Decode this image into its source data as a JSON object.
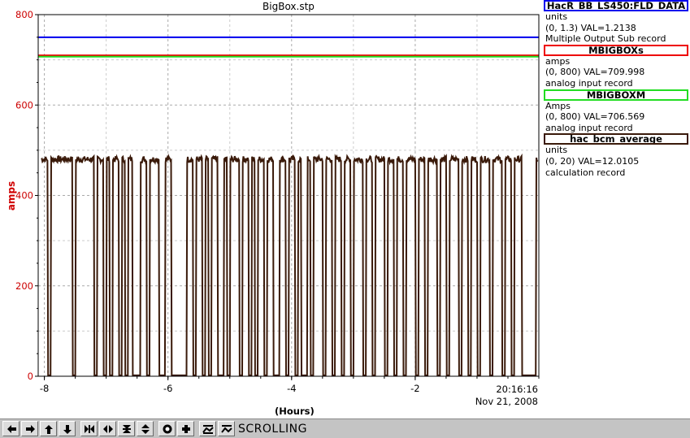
{
  "window_title": "BigBox.stp",
  "y_axis_label": "amps",
  "x_axis_label": "(Hours)",
  "end_time": "20:16:16",
  "end_date": "Nov 21, 2008",
  "legend": [
    {
      "name": "HacR_BB_LS450:FLD_DATA",
      "color": "#0000ee",
      "units": "units",
      "range_val": "(0, 1.3) VAL=1.2138",
      "record": "Multiple Output Sub record"
    },
    {
      "name": "MBIGBOXs",
      "color": "#ee0000",
      "units": "amps",
      "range_val": "(0, 800) VAL=709.998",
      "record": "analog input record"
    },
    {
      "name": "MBIGBOXM",
      "color": "#22dd22",
      "units": "Amps",
      "range_val": "(0, 800) VAL=706.569",
      "record": "analog input record"
    },
    {
      "name": "hac_bcm_average",
      "color": "#3a1a0a",
      "units": "units",
      "range_val": "(0, 20) VAL=12.0105",
      "record": "calculation record"
    }
  ],
  "toolbar": {
    "status": "SCROLLING",
    "buttons": [
      {
        "name": "scroll-left-icon"
      },
      {
        "name": "scroll-right-icon"
      },
      {
        "name": "scroll-up-icon"
      },
      {
        "name": "scroll-down-icon"
      },
      {
        "name": "zoom-in-horizontal-icon"
      },
      {
        "name": "zoom-out-horizontal-icon"
      },
      {
        "name": "zoom-in-vertical-icon"
      },
      {
        "name": "zoom-out-vertical-icon"
      },
      {
        "name": "record-icon"
      },
      {
        "name": "plus-icon"
      },
      {
        "name": "autoscale-icon"
      },
      {
        "name": "scroll-toggle-icon"
      }
    ]
  },
  "chart_data": {
    "type": "line",
    "xlabel": "(Hours)",
    "ylabel": "amps",
    "xlim": [
      -8.1,
      0
    ],
    "ylim": [
      0,
      800
    ],
    "x_ticks": [
      -8,
      -6,
      -4,
      -2
    ],
    "y_ticks": [
      0,
      200,
      400,
      600,
      800
    ],
    "grid": true,
    "series": [
      {
        "name": "HacR_BB_LS450:FLD_DATA",
        "color": "#0000ee",
        "constant": 750
      },
      {
        "name": "MBIGBOXs",
        "color": "#ee0000",
        "constant": 710
      },
      {
        "name": "MBIGBOXM",
        "color": "#22dd22",
        "constant": 707
      },
      {
        "name": "hac_bcm_average",
        "color": "#3a1a0a",
        "baseline": 480,
        "dropouts": [
          [
            -7.95,
            -7.9
          ],
          [
            -7.55,
            -7.5
          ],
          [
            -7.2,
            -7.15
          ],
          [
            -7.05,
            -7.0
          ],
          [
            -6.95,
            -6.9
          ],
          [
            -6.8,
            -6.75
          ],
          [
            -6.7,
            -6.65
          ],
          [
            -6.58,
            -6.45
          ],
          [
            -6.35,
            -6.3
          ],
          [
            -6.15,
            -6.05
          ],
          [
            -5.95,
            -5.7
          ],
          [
            -5.6,
            -5.55
          ],
          [
            -5.45,
            -5.4
          ],
          [
            -5.35,
            -5.3
          ],
          [
            -5.2,
            -5.1
          ],
          [
            -5.05,
            -5.0
          ],
          [
            -4.85,
            -4.8
          ],
          [
            -4.7,
            -4.65
          ],
          [
            -4.6,
            -4.55
          ],
          [
            -4.45,
            -4.4
          ],
          [
            -4.3,
            -4.2
          ],
          [
            -4.1,
            -4.05
          ],
          [
            -3.95,
            -3.9
          ],
          [
            -3.85,
            -3.75
          ],
          [
            -3.7,
            -3.65
          ],
          [
            -3.5,
            -3.45
          ],
          [
            -3.35,
            -3.3
          ],
          [
            -3.2,
            -3.15
          ],
          [
            -3.05,
            -3.0
          ],
          [
            -2.85,
            -2.8
          ],
          [
            -2.7,
            -2.65
          ],
          [
            -2.5,
            -2.45
          ],
          [
            -2.35,
            -2.3
          ],
          [
            -2.2,
            -2.15
          ],
          [
            -2.0,
            -1.95
          ],
          [
            -1.85,
            -1.8
          ],
          [
            -1.65,
            -1.6
          ],
          [
            -1.5,
            -1.45
          ],
          [
            -1.3,
            -1.25
          ],
          [
            -1.15,
            -1.1
          ],
          [
            -1.0,
            -0.95
          ],
          [
            -0.8,
            -0.75
          ],
          [
            -0.6,
            -0.55
          ],
          [
            -0.45,
            -0.4
          ],
          [
            -0.28,
            -0.05
          ]
        ]
      }
    ]
  }
}
